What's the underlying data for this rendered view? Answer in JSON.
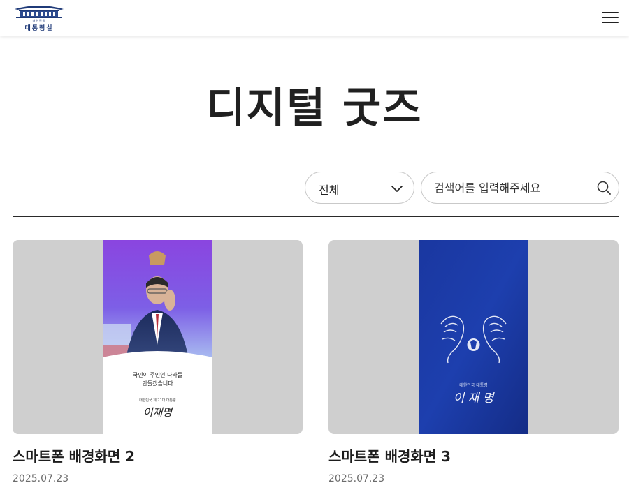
{
  "header": {
    "logo": {
      "sub_text": "대한민국",
      "main_text": "대통령실"
    }
  },
  "page": {
    "title": "디지털 굿즈"
  },
  "filter": {
    "category_selected": "전체",
    "search_placeholder": "검색어를 입력해주세요"
  },
  "colors": {
    "title": "#202020",
    "border": "#c9c9c9",
    "thumb_bg": "#cfcfcf",
    "date": "#6b6b6b",
    "brand_navy": "#1f3a78"
  },
  "items": [
    {
      "title": "스마트폰 배경화면 2",
      "date": "2025.07.23",
      "wallpaper": {
        "slogan_line1": "국민이 주인인 나라를",
        "slogan_line2": "만들겠습니다",
        "caption": "대한민국 제 21대 대통령",
        "signature": "이재명"
      }
    },
    {
      "title": "스마트폰 배경화면 3",
      "date": "2025.07.23",
      "wallpaper": {
        "caption": "대한민국 대통령",
        "signature": "이 재 명"
      }
    }
  ],
  "icons": [
    "presidential-office-logo-icon",
    "hamburger-menu-icon",
    "chevron-down-icon",
    "search-icon",
    "phoenix-emblem-icon"
  ]
}
